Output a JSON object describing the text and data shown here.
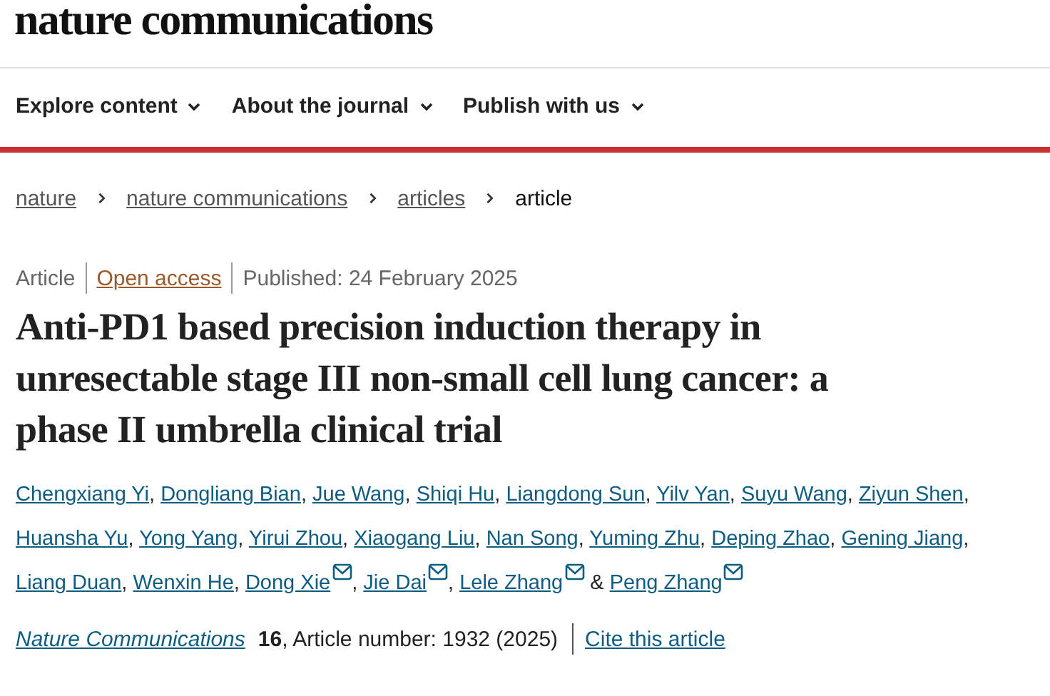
{
  "header": {
    "logo": "nature communications"
  },
  "nav": [
    {
      "label": "Explore content",
      "expanded": false
    },
    {
      "label": "About the journal",
      "expanded": false
    },
    {
      "label": "Publish with us",
      "expanded": false
    }
  ],
  "breadcrumb": [
    {
      "label": "nature",
      "kind": "link"
    },
    {
      "label": "nature communications",
      "kind": "link"
    },
    {
      "label": "articles",
      "kind": "link"
    },
    {
      "label": "article",
      "kind": "current"
    }
  ],
  "article_meta": {
    "type": "Article",
    "access": "Open access",
    "published": "Published: 24 February 2025"
  },
  "title": "Anti-PD1 based precision induction therapy in unresectable stage III non-small cell lung cancer: a phase II umbrella clinical trial",
  "authors": {
    "separator": ",",
    "final_joiner": "&",
    "list": [
      {
        "name": "Chengxiang Yi",
        "email": false
      },
      {
        "name": "Dongliang Bian",
        "email": false
      },
      {
        "name": "Jue Wang",
        "email": false
      },
      {
        "name": "Shiqi Hu",
        "email": false
      },
      {
        "name": "Liangdong Sun",
        "email": false
      },
      {
        "name": "Yilv Yan",
        "email": false
      },
      {
        "name": "Suyu Wang",
        "email": false
      },
      {
        "name": "Ziyun Shen",
        "email": false
      },
      {
        "name": "Huansha Yu",
        "email": false
      },
      {
        "name": "Yong Yang",
        "email": false
      },
      {
        "name": "Yirui Zhou",
        "email": false
      },
      {
        "name": "Xiaogang Liu",
        "email": false
      },
      {
        "name": "Nan Song",
        "email": false
      },
      {
        "name": "Yuming Zhu",
        "email": false
      },
      {
        "name": "Deping Zhao",
        "email": false
      },
      {
        "name": "Gening Jiang",
        "email": false
      },
      {
        "name": "Liang Duan",
        "email": false
      },
      {
        "name": "Wenxin He",
        "email": false
      },
      {
        "name": "Dong Xie",
        "email": true
      },
      {
        "name": "Jie Dai",
        "email": true
      },
      {
        "name": "Lele Zhang",
        "email": true
      },
      {
        "name": "Peng Zhang",
        "email": true
      }
    ]
  },
  "citation": {
    "journal": "Nature Communications",
    "volume": "16",
    "details": ", Article number: 1932 (2025)",
    "cite_link": "Cite this article"
  }
}
